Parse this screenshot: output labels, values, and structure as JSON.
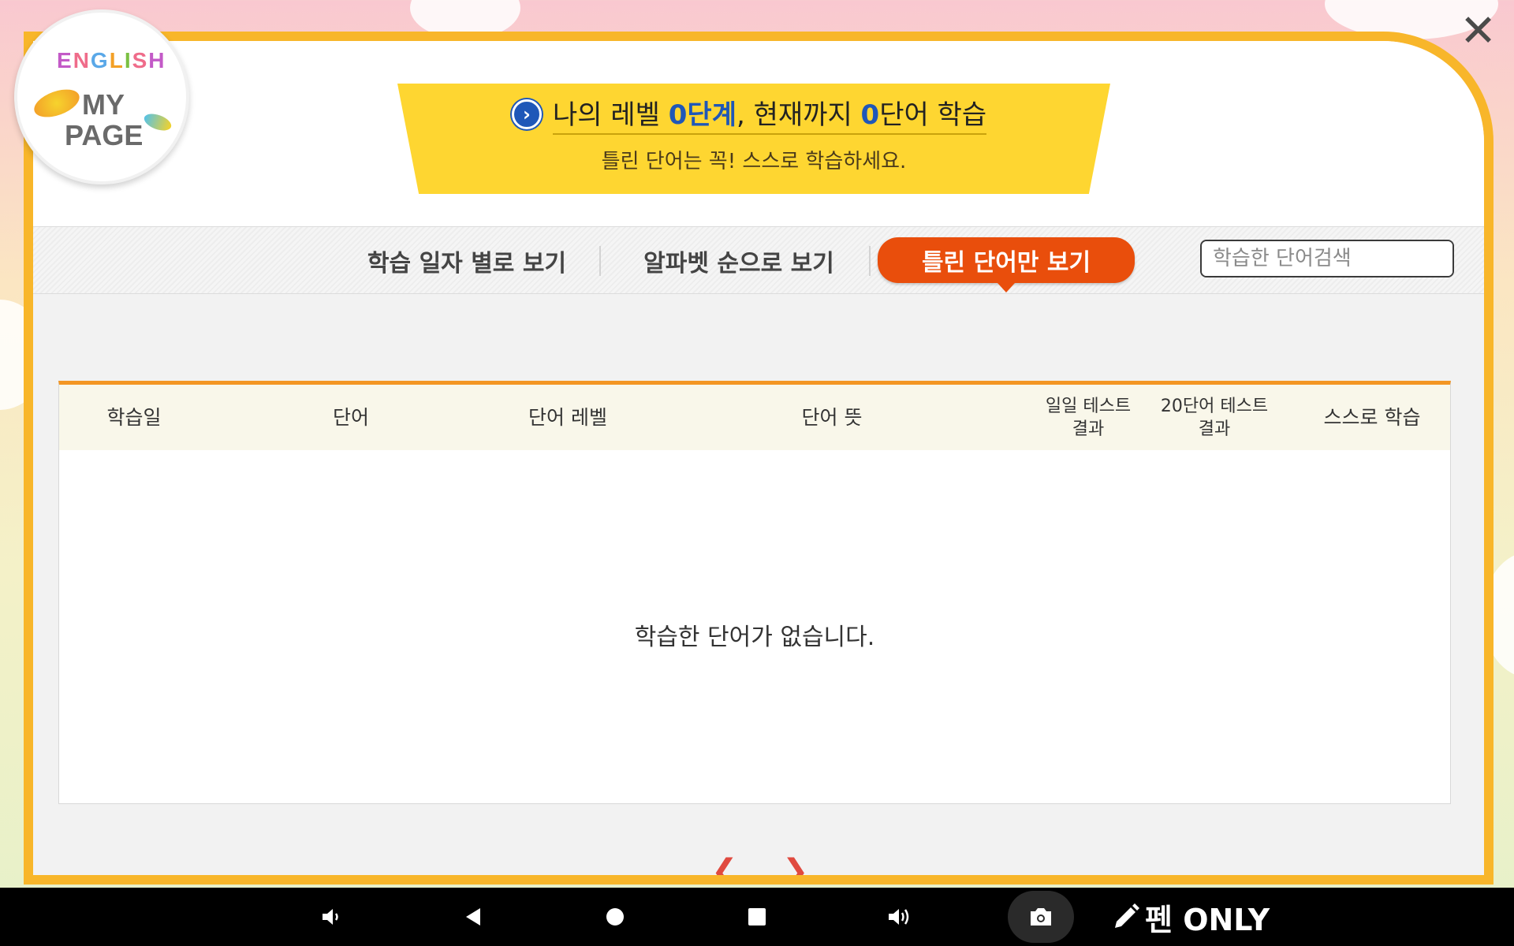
{
  "logo": {
    "english_letters": [
      "E",
      "N",
      "G",
      "L",
      "I",
      "S",
      "H"
    ],
    "my": "MY",
    "page": "PAGE"
  },
  "banner": {
    "prefix": "나의 레벨 ",
    "level_num": "0",
    "level_unit": "단계",
    "mid": ", 현재까지 ",
    "word_num": "0",
    "suffix": "단어 학습",
    "subtitle": "틀린 단어는 꼭! 스스로 학습하세요."
  },
  "tabs": [
    {
      "label": "학습 일자 별로 보기",
      "active": false
    },
    {
      "label": "알파벳 순으로 보기",
      "active": false
    },
    {
      "label": "틀린 단어만 보기",
      "active": true
    }
  ],
  "search": {
    "placeholder": "학습한 단어검색",
    "value": ""
  },
  "table": {
    "columns": [
      {
        "line1": "학습일",
        "line2": ""
      },
      {
        "line1": "단어",
        "line2": ""
      },
      {
        "line1": "단어 레벨",
        "line2": ""
      },
      {
        "line1": "단어 뜻",
        "line2": ""
      },
      {
        "line1": "일일 테스트",
        "line2": "결과"
      },
      {
        "line1": "20단어 테스트",
        "line2": "결과"
      },
      {
        "line1": "스스로 학습",
        "line2": ""
      }
    ],
    "empty_message": "학습한 단어가 없습니다."
  },
  "pager": {
    "prev": "❮",
    "next": "❯"
  },
  "close": "✕",
  "navbar": {
    "icons": [
      "volume-down-icon",
      "back-icon",
      "home-icon",
      "recents-icon",
      "volume-up-icon",
      "camera-icon",
      "pen-icon"
    ],
    "pen_label": "펜 ONLY"
  },
  "colors": {
    "frame": "#f8b62a",
    "banner": "#fed631",
    "active_tab": "#e94e0c",
    "table_top_border": "#f39623",
    "number_highlight": "#1f57b8",
    "pager": "#e04a3f"
  }
}
